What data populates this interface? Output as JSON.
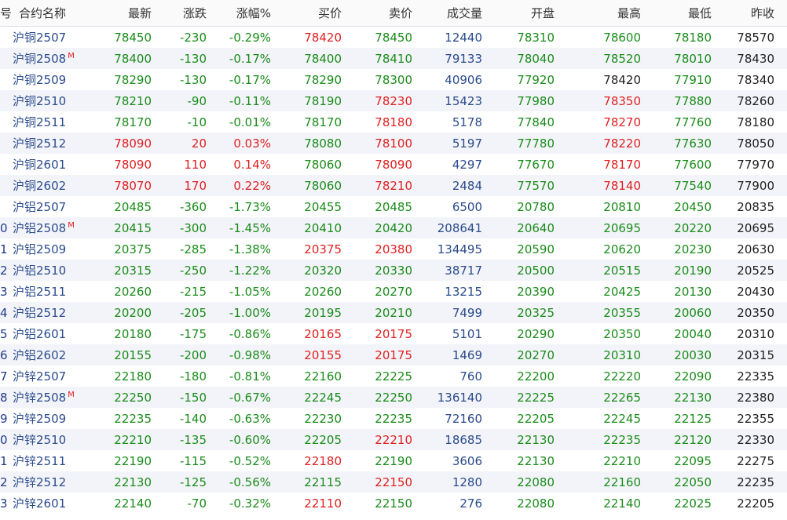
{
  "header": [
    "号",
    "合约名称",
    "最新",
    "涨跌",
    "涨幅%",
    "买价",
    "卖价",
    "成交量",
    "开盘",
    "最高",
    "最低",
    "昨收"
  ],
  "rows": [
    {
      "no": "",
      "name": "沪铜2507",
      "main": "",
      "last": "78450",
      "chg": "-230",
      "pct": "-0.29%",
      "bid": "78420",
      "ask": "78450",
      "vol": "12440",
      "open": "78310",
      "high": "78600",
      "low": "78180",
      "prev": "78570",
      "colors": {
        "last": "g",
        "chg": "g",
        "pct": "g",
        "bid": "r",
        "ask": "g",
        "vol": "b",
        "open": "g",
        "high": "g",
        "low": "g",
        "prev": "k"
      }
    },
    {
      "no": "",
      "name": "沪铜2508",
      "main": "M",
      "last": "78400",
      "chg": "-130",
      "pct": "-0.17%",
      "bid": "78400",
      "ask": "78410",
      "vol": "79133",
      "open": "78040",
      "high": "78520",
      "low": "78010",
      "prev": "78430",
      "colors": {
        "last": "g",
        "chg": "g",
        "pct": "g",
        "bid": "g",
        "ask": "g",
        "vol": "b",
        "open": "g",
        "high": "g",
        "low": "g",
        "prev": "k"
      }
    },
    {
      "no": "",
      "name": "沪铜2509",
      "main": "",
      "last": "78290",
      "chg": "-130",
      "pct": "-0.17%",
      "bid": "78290",
      "ask": "78300",
      "vol": "40906",
      "open": "77920",
      "high": "78420",
      "low": "77910",
      "prev": "78340",
      "colors": {
        "last": "g",
        "chg": "g",
        "pct": "g",
        "bid": "g",
        "ask": "g",
        "vol": "b",
        "open": "g",
        "high": "k",
        "low": "g",
        "prev": "k"
      }
    },
    {
      "no": "",
      "name": "沪铜2510",
      "main": "",
      "last": "78210",
      "chg": "-90",
      "pct": "-0.11%",
      "bid": "78190",
      "ask": "78230",
      "vol": "15423",
      "open": "77980",
      "high": "78350",
      "low": "77880",
      "prev": "78260",
      "colors": {
        "last": "g",
        "chg": "g",
        "pct": "g",
        "bid": "g",
        "ask": "r",
        "vol": "b",
        "open": "g",
        "high": "r",
        "low": "g",
        "prev": "k"
      }
    },
    {
      "no": "",
      "name": "沪铜2511",
      "main": "",
      "last": "78170",
      "chg": "-10",
      "pct": "-0.01%",
      "bid": "78170",
      "ask": "78180",
      "vol": "5178",
      "open": "77840",
      "high": "78270",
      "low": "77760",
      "prev": "78180",
      "colors": {
        "last": "g",
        "chg": "g",
        "pct": "g",
        "bid": "g",
        "ask": "r",
        "vol": "b",
        "open": "g",
        "high": "r",
        "low": "g",
        "prev": "k"
      }
    },
    {
      "no": "",
      "name": "沪铜2512",
      "main": "",
      "last": "78090",
      "chg": "20",
      "pct": "0.03%",
      "bid": "78080",
      "ask": "78100",
      "vol": "5197",
      "open": "77780",
      "high": "78220",
      "low": "77630",
      "prev": "78050",
      "colors": {
        "last": "r",
        "chg": "r",
        "pct": "r",
        "bid": "g",
        "ask": "r",
        "vol": "b",
        "open": "g",
        "high": "r",
        "low": "g",
        "prev": "k"
      }
    },
    {
      "no": "",
      "name": "沪铜2601",
      "main": "",
      "last": "78090",
      "chg": "110",
      "pct": "0.14%",
      "bid": "78060",
      "ask": "78090",
      "vol": "4297",
      "open": "77670",
      "high": "78170",
      "low": "77600",
      "prev": "77970",
      "colors": {
        "last": "r",
        "chg": "r",
        "pct": "r",
        "bid": "g",
        "ask": "r",
        "vol": "b",
        "open": "g",
        "high": "r",
        "low": "g",
        "prev": "k"
      }
    },
    {
      "no": "",
      "name": "沪铜2602",
      "main": "",
      "last": "78070",
      "chg": "170",
      "pct": "0.22%",
      "bid": "78060",
      "ask": "78210",
      "vol": "2484",
      "open": "77570",
      "high": "78140",
      "low": "77540",
      "prev": "77900",
      "colors": {
        "last": "r",
        "chg": "r",
        "pct": "r",
        "bid": "g",
        "ask": "r",
        "vol": "b",
        "open": "g",
        "high": "r",
        "low": "g",
        "prev": "k"
      }
    },
    {
      "no": "",
      "name": "沪铝2507",
      "main": "",
      "last": "20485",
      "chg": "-360",
      "pct": "-1.73%",
      "bid": "20455",
      "ask": "20485",
      "vol": "6500",
      "open": "20780",
      "high": "20810",
      "low": "20450",
      "prev": "20835",
      "colors": {
        "last": "g",
        "chg": "g",
        "pct": "g",
        "bid": "g",
        "ask": "g",
        "vol": "b",
        "open": "g",
        "high": "g",
        "low": "g",
        "prev": "k"
      }
    },
    {
      "no": "0",
      "name": "沪铝2508",
      "main": "M",
      "last": "20415",
      "chg": "-300",
      "pct": "-1.45%",
      "bid": "20410",
      "ask": "20420",
      "vol": "208641",
      "open": "20640",
      "high": "20695",
      "low": "20220",
      "prev": "20695",
      "colors": {
        "last": "g",
        "chg": "g",
        "pct": "g",
        "bid": "g",
        "ask": "g",
        "vol": "b",
        "open": "g",
        "high": "g",
        "low": "g",
        "prev": "k"
      }
    },
    {
      "no": "1",
      "name": "沪铝2509",
      "main": "",
      "last": "20375",
      "chg": "-285",
      "pct": "-1.38%",
      "bid": "20375",
      "ask": "20380",
      "vol": "134495",
      "open": "20590",
      "high": "20620",
      "low": "20230",
      "prev": "20630",
      "colors": {
        "last": "g",
        "chg": "g",
        "pct": "g",
        "bid": "r",
        "ask": "r",
        "vol": "b",
        "open": "g",
        "high": "g",
        "low": "g",
        "prev": "k"
      }
    },
    {
      "no": "2",
      "name": "沪铝2510",
      "main": "",
      "last": "20315",
      "chg": "-250",
      "pct": "-1.22%",
      "bid": "20320",
      "ask": "20330",
      "vol": "38717",
      "open": "20500",
      "high": "20515",
      "low": "20190",
      "prev": "20525",
      "colors": {
        "last": "g",
        "chg": "g",
        "pct": "g",
        "bid": "g",
        "ask": "g",
        "vol": "b",
        "open": "g",
        "high": "g",
        "low": "g",
        "prev": "k"
      }
    },
    {
      "no": "3",
      "name": "沪铝2511",
      "main": "",
      "last": "20260",
      "chg": "-215",
      "pct": "-1.05%",
      "bid": "20260",
      "ask": "20270",
      "vol": "13215",
      "open": "20390",
      "high": "20425",
      "low": "20130",
      "prev": "20430",
      "colors": {
        "last": "g",
        "chg": "g",
        "pct": "g",
        "bid": "g",
        "ask": "g",
        "vol": "b",
        "open": "g",
        "high": "g",
        "low": "g",
        "prev": "k"
      }
    },
    {
      "no": "4",
      "name": "沪铝2512",
      "main": "",
      "last": "20200",
      "chg": "-205",
      "pct": "-1.00%",
      "bid": "20195",
      "ask": "20210",
      "vol": "7499",
      "open": "20325",
      "high": "20355",
      "low": "20060",
      "prev": "20350",
      "colors": {
        "last": "g",
        "chg": "g",
        "pct": "g",
        "bid": "g",
        "ask": "g",
        "vol": "b",
        "open": "g",
        "high": "g",
        "low": "g",
        "prev": "k"
      }
    },
    {
      "no": "5",
      "name": "沪铝2601",
      "main": "",
      "last": "20180",
      "chg": "-175",
      "pct": "-0.86%",
      "bid": "20165",
      "ask": "20175",
      "vol": "5101",
      "open": "20290",
      "high": "20350",
      "low": "20040",
      "prev": "20310",
      "colors": {
        "last": "g",
        "chg": "g",
        "pct": "g",
        "bid": "r",
        "ask": "r",
        "vol": "b",
        "open": "g",
        "high": "g",
        "low": "g",
        "prev": "k"
      }
    },
    {
      "no": "6",
      "name": "沪铝2602",
      "main": "",
      "last": "20155",
      "chg": "-200",
      "pct": "-0.98%",
      "bid": "20155",
      "ask": "20175",
      "vol": "1469",
      "open": "20270",
      "high": "20310",
      "low": "20030",
      "prev": "20315",
      "colors": {
        "last": "g",
        "chg": "g",
        "pct": "g",
        "bid": "r",
        "ask": "r",
        "vol": "b",
        "open": "g",
        "high": "g",
        "low": "g",
        "prev": "k"
      }
    },
    {
      "no": "7",
      "name": "沪锌2507",
      "main": "",
      "last": "22180",
      "chg": "-180",
      "pct": "-0.81%",
      "bid": "22160",
      "ask": "22225",
      "vol": "760",
      "open": "22200",
      "high": "22220",
      "low": "22090",
      "prev": "22335",
      "colors": {
        "last": "g",
        "chg": "g",
        "pct": "g",
        "bid": "g",
        "ask": "g",
        "vol": "b",
        "open": "g",
        "high": "g",
        "low": "g",
        "prev": "k"
      }
    },
    {
      "no": "8",
      "name": "沪锌2508",
      "main": "M",
      "last": "22250",
      "chg": "-150",
      "pct": "-0.67%",
      "bid": "22245",
      "ask": "22250",
      "vol": "136140",
      "open": "22225",
      "high": "22265",
      "low": "22130",
      "prev": "22380",
      "colors": {
        "last": "g",
        "chg": "g",
        "pct": "g",
        "bid": "g",
        "ask": "g",
        "vol": "b",
        "open": "g",
        "high": "g",
        "low": "g",
        "prev": "k"
      }
    },
    {
      "no": "9",
      "name": "沪锌2509",
      "main": "",
      "last": "22235",
      "chg": "-140",
      "pct": "-0.63%",
      "bid": "22230",
      "ask": "22235",
      "vol": "72160",
      "open": "22205",
      "high": "22245",
      "low": "22125",
      "prev": "22355",
      "colors": {
        "last": "g",
        "chg": "g",
        "pct": "g",
        "bid": "g",
        "ask": "g",
        "vol": "b",
        "open": "g",
        "high": "g",
        "low": "g",
        "prev": "k"
      }
    },
    {
      "no": "0",
      "name": "沪锌2510",
      "main": "",
      "last": "22210",
      "chg": "-135",
      "pct": "-0.60%",
      "bid": "22205",
      "ask": "22210",
      "vol": "18685",
      "open": "22130",
      "high": "22235",
      "low": "22120",
      "prev": "22330",
      "colors": {
        "last": "g",
        "chg": "g",
        "pct": "g",
        "bid": "g",
        "ask": "r",
        "vol": "b",
        "open": "g",
        "high": "g",
        "low": "g",
        "prev": "k"
      }
    },
    {
      "no": "1",
      "name": "沪锌2511",
      "main": "",
      "last": "22190",
      "chg": "-115",
      "pct": "-0.52%",
      "bid": "22180",
      "ask": "22190",
      "vol": "3606",
      "open": "22130",
      "high": "22210",
      "low": "22095",
      "prev": "22275",
      "colors": {
        "last": "g",
        "chg": "g",
        "pct": "g",
        "bid": "r",
        "ask": "g",
        "vol": "b",
        "open": "g",
        "high": "g",
        "low": "g",
        "prev": "k"
      }
    },
    {
      "no": "2",
      "name": "沪锌2512",
      "main": "",
      "last": "22130",
      "chg": "-125",
      "pct": "-0.56%",
      "bid": "22115",
      "ask": "22150",
      "vol": "1280",
      "open": "22080",
      "high": "22160",
      "low": "22050",
      "prev": "22235",
      "colors": {
        "last": "g",
        "chg": "g",
        "pct": "g",
        "bid": "g",
        "ask": "r",
        "vol": "b",
        "open": "g",
        "high": "g",
        "low": "g",
        "prev": "k"
      }
    },
    {
      "no": "3",
      "name": "沪锌2601",
      "main": "",
      "last": "22140",
      "chg": "-70",
      "pct": "-0.32%",
      "bid": "22110",
      "ask": "22150",
      "vol": "276",
      "open": "22080",
      "high": "22140",
      "low": "22025",
      "prev": "22205",
      "colors": {
        "last": "g",
        "chg": "g",
        "pct": "g",
        "bid": "r",
        "ask": "g",
        "vol": "b",
        "open": "g",
        "high": "g",
        "low": "g",
        "prev": "k"
      }
    }
  ]
}
